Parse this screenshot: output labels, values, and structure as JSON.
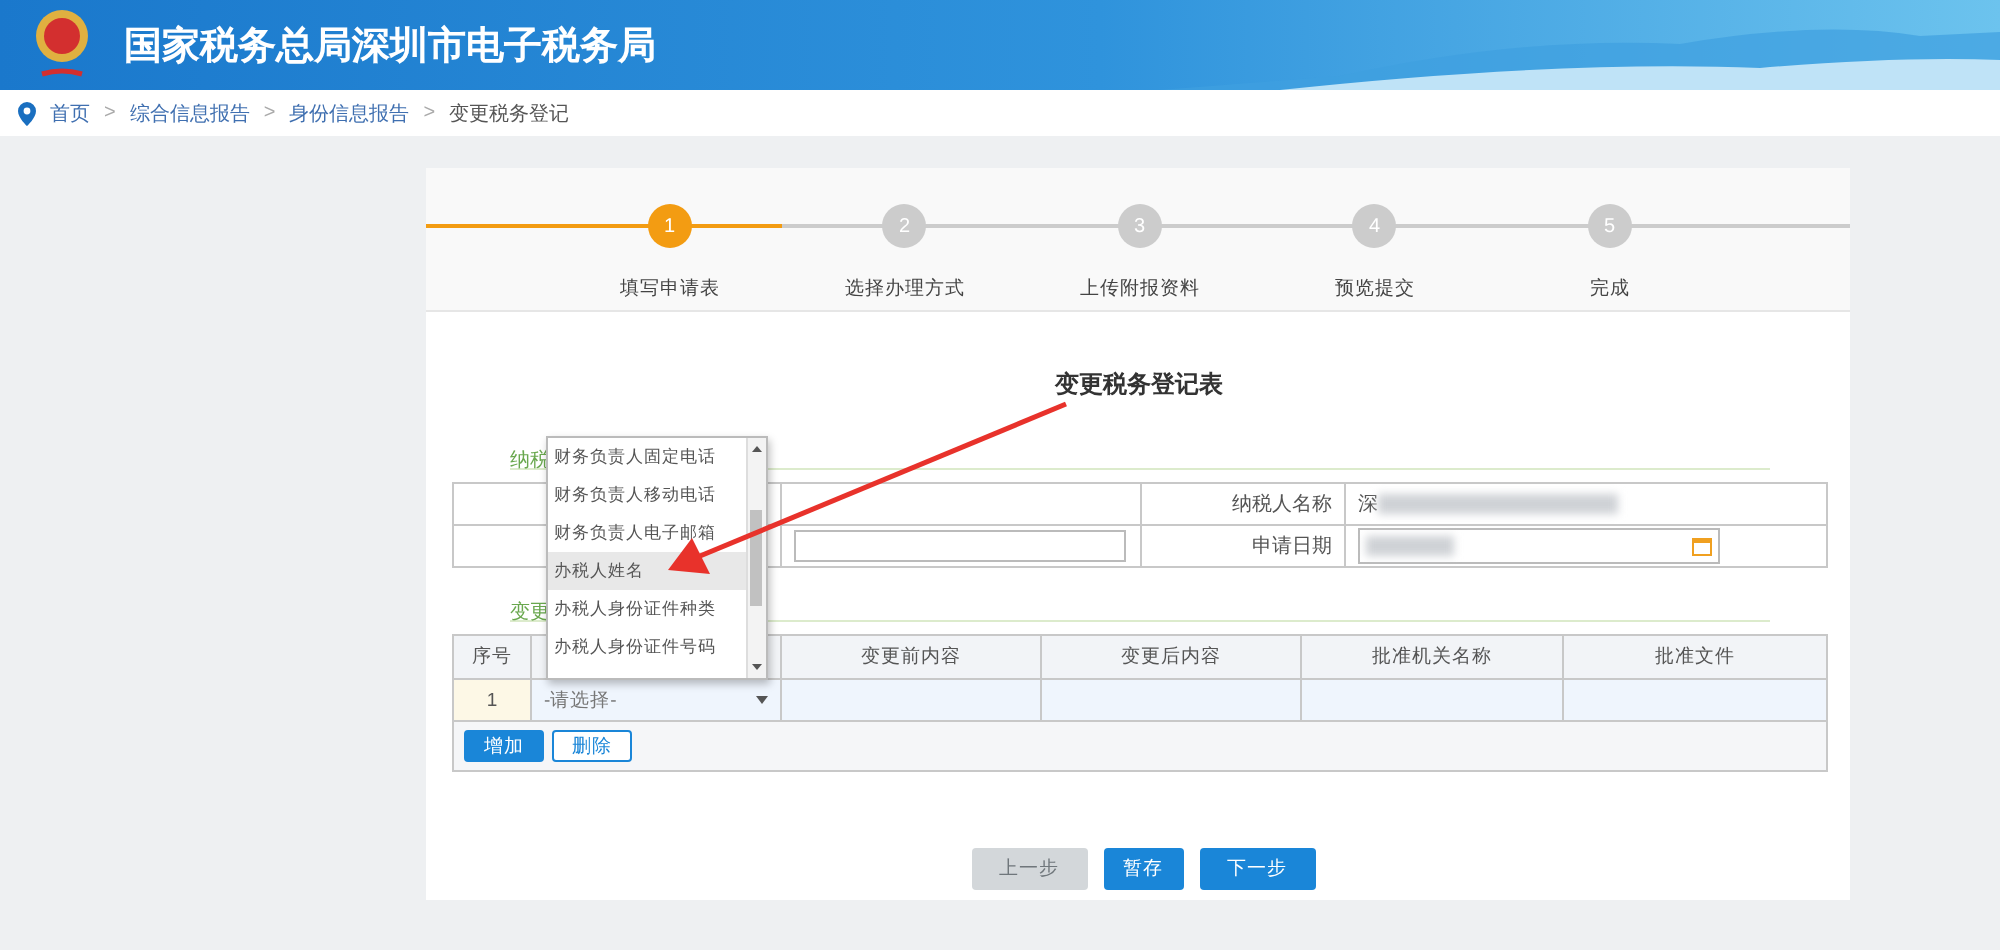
{
  "header": {
    "title": "国家税务总局深圳市电子税务局"
  },
  "breadcrumb": {
    "separator": ">",
    "items": [
      {
        "label": "首页",
        "link": true
      },
      {
        "label": "综合信息报告",
        "link": true
      },
      {
        "label": "身份信息报告",
        "link": true
      },
      {
        "label": "变更税务登记",
        "link": false
      }
    ]
  },
  "steps": [
    {
      "number": "1",
      "label": "填写申请表",
      "selected": true
    },
    {
      "number": "2",
      "label": "选择办理方式",
      "selected": false
    },
    {
      "number": "3",
      "label": "上传附报资料",
      "selected": false
    },
    {
      "number": "4",
      "label": "预览提交",
      "selected": false
    },
    {
      "number": "5",
      "label": "完成",
      "selected": false
    }
  ],
  "step_progress": {
    "level": 0.25
  },
  "form_title": "变更税务登记表",
  "sections": [
    {
      "label": "纳税"
    },
    {
      "label": "变更"
    }
  ],
  "info_table": {
    "rows": [
      [
        {
          "kind": "blank"
        },
        {
          "kind": "blank"
        },
        {
          "kind": "label",
          "text": "纳税人名称"
        },
        {
          "kind": "value",
          "text": "深",
          "redacted": true
        }
      ],
      [
        {
          "kind": "blank"
        },
        {
          "kind": "input"
        },
        {
          "kind": "label",
          "text": "申请日期"
        },
        {
          "kind": "date",
          "redacted": true
        }
      ]
    ]
  },
  "change_table": {
    "columns": [
      {
        "kind": "text",
        "label": "序号"
      },
      {
        "kind": "covered"
      },
      {
        "kind": "text",
        "label": "变更前内容"
      },
      {
        "kind": "text",
        "label": "变更后内容"
      },
      {
        "kind": "text",
        "label": "批准机关名称"
      },
      {
        "kind": "text",
        "label": "批准文件"
      }
    ],
    "rows": [
      {
        "number": "1",
        "select": "-请选择-"
      }
    ],
    "actions": [
      {
        "label": "增加",
        "primary": true
      },
      {
        "label": "删除",
        "primary": false
      }
    ]
  },
  "dropdown": {
    "items": [
      {
        "label": "财务负责人固定电话",
        "selected": false
      },
      {
        "label": "财务负责人移动电话",
        "selected": false
      },
      {
        "label": "财务负责人电子邮箱",
        "selected": false
      },
      {
        "label": "办税人姓名",
        "selected": true
      },
      {
        "label": "办税人身份证件种类",
        "selected": false
      },
      {
        "label": "办税人身份证件号码",
        "selected": false
      }
    ]
  },
  "nav_buttons": [
    {
      "label": "上一步",
      "disabled": true
    },
    {
      "label": "暂存",
      "disabled": false
    },
    {
      "label": "下一步",
      "disabled": false
    }
  ],
  "annotation": {
    "kind": "arrow"
  }
}
